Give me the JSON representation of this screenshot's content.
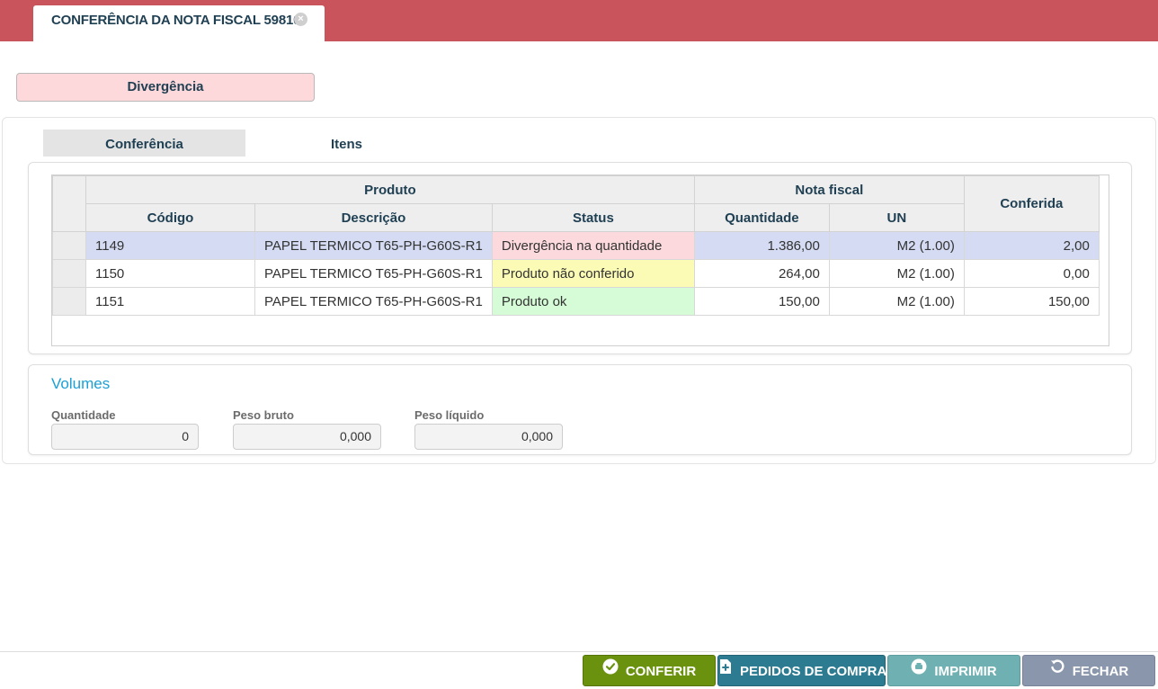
{
  "header": {
    "tab_title": "CONFERÊNCIA DA NOTA FISCAL 59810",
    "close_glyph": "×"
  },
  "status_label": "Divergência",
  "subtabs": [
    {
      "label": "Conferência",
      "active": true
    },
    {
      "label": "Itens",
      "active": false
    }
  ],
  "grid": {
    "group_headers": {
      "produto": "Produto",
      "nota_fiscal": "Nota fiscal",
      "conferida": "Conferida"
    },
    "columns": [
      "Código",
      "Descrição",
      "Status",
      "Quantidade",
      "UN"
    ],
    "rows": [
      {
        "codigo": "1149",
        "descricao": "PAPEL TERMICO T65-PH-G60S-R1",
        "status": "Divergência na quantidade",
        "status_color": "#fcd9dc",
        "quantidade": "1.386,00",
        "un": "M2 (1.00)",
        "conferida": "2,00"
      },
      {
        "codigo": "1150",
        "descricao": "PAPEL TERMICO T65-PH-G60S-R1",
        "status": "Produto não conferido",
        "status_color": "#fbfbb6",
        "quantidade": "264,00",
        "un": "M2 (1.00)",
        "conferida": "0,00"
      },
      {
        "codigo": "1151",
        "descricao": "PAPEL TERMICO T65-PH-G60S-R1",
        "status": "Produto ok",
        "status_color": "#d5fcd6",
        "quantidade": "150,00",
        "un": "M2 (1.00)",
        "conferida": "150,00"
      }
    ]
  },
  "volumes": {
    "title": "Volumes",
    "quantidade_label": "Quantidade",
    "quantidade_value": "0",
    "peso_bruto_label": "Peso bruto",
    "peso_bruto_value": "0,000",
    "peso_liquido_label": "Peso líquido",
    "peso_liquido_value": "0,000"
  },
  "buttons": {
    "conferir": "CONFERIR",
    "pedidos": "PEDIDOS DE COMPRA",
    "imprimir": "IMPRIMIR",
    "fechar": "FECHAR"
  },
  "colors": {
    "topbar": "#c9545b",
    "accent_blue": "#1a9fd6",
    "selected_row": "#d4dbf2"
  }
}
